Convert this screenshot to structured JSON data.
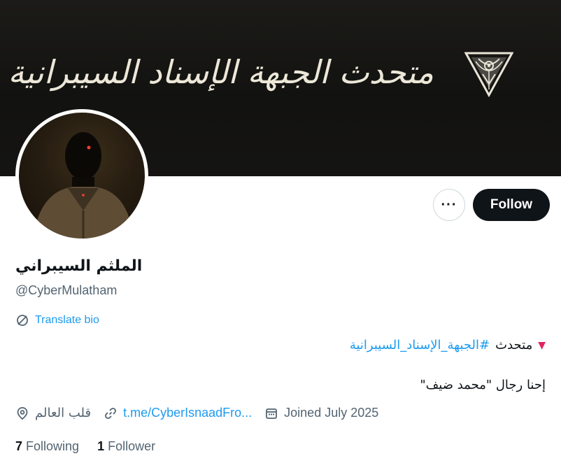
{
  "banner": {
    "title": "متحدث الجبهة الإسناد السيبرانية",
    "logo_icon": "ornamental-triangle-icon",
    "background_color": "#141311"
  },
  "profile": {
    "display_name": "الملثم السيبراني",
    "handle": "@CyberMulatham",
    "avatar_icon": "masked-person-avatar"
  },
  "actions": {
    "more_label": "···",
    "follow_label": "Follow"
  },
  "translate": {
    "label": "Translate bio",
    "icon": "translate-globe-icon"
  },
  "bio": {
    "line1_prefix": "متحدث",
    "line1_hashtag": "#الجبهة_الإسناد_السيبرانية",
    "line1_icon": "red-triangle-icon",
    "line2": "إحنا رجال \"محمد ضيف\""
  },
  "meta": {
    "location": "قلب العالم",
    "location_icon": "location-pin-icon",
    "link": "t.me/CyberIsnaadFro...",
    "link_icon": "link-icon",
    "joined": "Joined July 2025",
    "joined_icon": "calendar-icon"
  },
  "stats": {
    "following_count": "7",
    "following_label": "Following",
    "followers_count": "1",
    "followers_label": "Follower"
  },
  "colors": {
    "accent": "#1d9bf0",
    "text": "#0f1419",
    "muted": "#536471",
    "triangle": "#e0245e"
  }
}
